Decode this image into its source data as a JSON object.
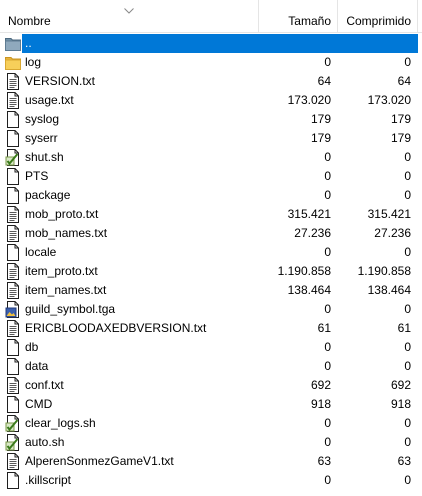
{
  "columns": {
    "name": "Nombre",
    "size": "Tamaño",
    "compressed": "Comprimido"
  },
  "colors": {
    "selection": "#0078d7",
    "folder": "#f7cf5a",
    "header_border": "#e5e5e5"
  },
  "rows": [
    {
      "name": "..",
      "size": "",
      "compressed": "",
      "icon": "parent-folder-icon",
      "selected": true
    },
    {
      "name": "log",
      "size": "0",
      "compressed": "0",
      "icon": "folder-icon"
    },
    {
      "name": "VERSION.txt",
      "size": "64",
      "compressed": "64",
      "icon": "text-file-icon"
    },
    {
      "name": "usage.txt",
      "size": "173.020",
      "compressed": "173.020",
      "icon": "text-file-icon"
    },
    {
      "name": "syslog",
      "size": "179",
      "compressed": "179",
      "icon": "file-icon"
    },
    {
      "name": "syserr",
      "size": "179",
      "compressed": "179",
      "icon": "file-icon"
    },
    {
      "name": "shut.sh",
      "size": "0",
      "compressed": "0",
      "icon": "script-file-icon"
    },
    {
      "name": "PTS",
      "size": "0",
      "compressed": "0",
      "icon": "file-icon"
    },
    {
      "name": "package",
      "size": "0",
      "compressed": "0",
      "icon": "file-icon"
    },
    {
      "name": "mob_proto.txt",
      "size": "315.421",
      "compressed": "315.421",
      "icon": "text-file-icon"
    },
    {
      "name": "mob_names.txt",
      "size": "27.236",
      "compressed": "27.236",
      "icon": "text-file-icon"
    },
    {
      "name": "locale",
      "size": "0",
      "compressed": "0",
      "icon": "file-icon"
    },
    {
      "name": "item_proto.txt",
      "size": "1.190.858",
      "compressed": "1.190.858",
      "icon": "text-file-icon"
    },
    {
      "name": "item_names.txt",
      "size": "138.464",
      "compressed": "138.464",
      "icon": "text-file-icon"
    },
    {
      "name": "guild_symbol.tga",
      "size": "0",
      "compressed": "0",
      "icon": "image-file-icon"
    },
    {
      "name": "ERICBLOODAXEDBVERSION.txt",
      "size": "61",
      "compressed": "61",
      "icon": "text-file-icon"
    },
    {
      "name": "db",
      "size": "0",
      "compressed": "0",
      "icon": "file-icon"
    },
    {
      "name": "data",
      "size": "0",
      "compressed": "0",
      "icon": "file-icon"
    },
    {
      "name": "conf.txt",
      "size": "692",
      "compressed": "692",
      "icon": "text-file-icon"
    },
    {
      "name": "CMD",
      "size": "918",
      "compressed": "918",
      "icon": "file-icon"
    },
    {
      "name": "clear_logs.sh",
      "size": "0",
      "compressed": "0",
      "icon": "script-file-icon"
    },
    {
      "name": "auto.sh",
      "size": "0",
      "compressed": "0",
      "icon": "script-file-icon"
    },
    {
      "name": "AlperenSonmezGameV1.txt",
      "size": "63",
      "compressed": "63",
      "icon": "text-file-icon"
    },
    {
      "name": ".killscript",
      "size": "0",
      "compressed": "0",
      "icon": "file-icon"
    }
  ]
}
